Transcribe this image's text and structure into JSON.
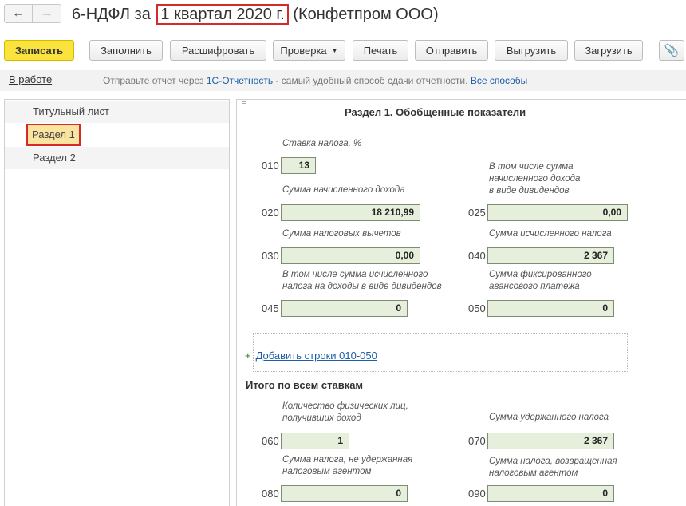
{
  "header": {
    "back_icon": "←",
    "forward_icon": "→",
    "title_prefix": "6-НДФЛ за",
    "title_period": "1 квартал 2020 г.",
    "title_org": "(Конфетпром ООО)"
  },
  "toolbar": {
    "write": "Записать",
    "fill": "Заполнить",
    "decode": "Расшифровать",
    "check": "Проверка",
    "print": "Печать",
    "send": "Отправить",
    "export": "Выгрузить",
    "import": "Загрузить",
    "attach_icon": "paperclip-icon"
  },
  "status": {
    "state": "В работе",
    "hint_before": "Отправьте отчет через",
    "hint_link": "1С-Отчетность",
    "hint_after": "- самый удобный способ сдачи отчетности.",
    "hint_all": "Все способы"
  },
  "sidebar": {
    "items": [
      {
        "label": "Титульный лист"
      },
      {
        "label": "Раздел 1"
      },
      {
        "label": "Раздел 2"
      }
    ]
  },
  "section": {
    "title": "Раздел 1. Обобщенные показатели",
    "rate_caption": "Ставка налога, %",
    "f010": {
      "code": "010",
      "value": "13"
    },
    "f020": {
      "code": "020",
      "caption": "Сумма начисленного дохода",
      "value": "18 210,99"
    },
    "f025": {
      "code": "025",
      "caption_lines": [
        "В том числе сумма",
        "начисленного дохода",
        "в виде дивидендов"
      ],
      "value": "0,00"
    },
    "f030": {
      "code": "030",
      "caption": "Сумма налоговых вычетов",
      "value": "0,00"
    },
    "f040": {
      "code": "040",
      "caption": "Сумма исчисленного налога",
      "value": "2 367"
    },
    "f045": {
      "code": "045",
      "caption_lines": [
        "В том числе сумма исчисленного",
        "налога на доходы в виде дивидендов"
      ],
      "value": "0"
    },
    "f050": {
      "code": "050",
      "caption_lines": [
        "Сумма фиксированного",
        "авансового платежа"
      ],
      "value": "0"
    },
    "add_rows": "Добавить строки 010-050",
    "add_icon": "+",
    "totals_title": "Итого по всем ставкам",
    "f060": {
      "code": "060",
      "caption_lines": [
        "Количество физических лиц,",
        "получивших доход"
      ],
      "value": "1"
    },
    "f070": {
      "code": "070",
      "caption": "Сумма удержанного налога",
      "value": "2 367"
    },
    "f080": {
      "code": "080",
      "caption_lines": [
        "Сумма налога, не удержанная",
        "налоговым агентом"
      ],
      "value": "0"
    },
    "f090": {
      "code": "090",
      "caption_lines": [
        "Сумма налога, возвращенная",
        "налоговым агентом"
      ],
      "value": "0"
    }
  }
}
